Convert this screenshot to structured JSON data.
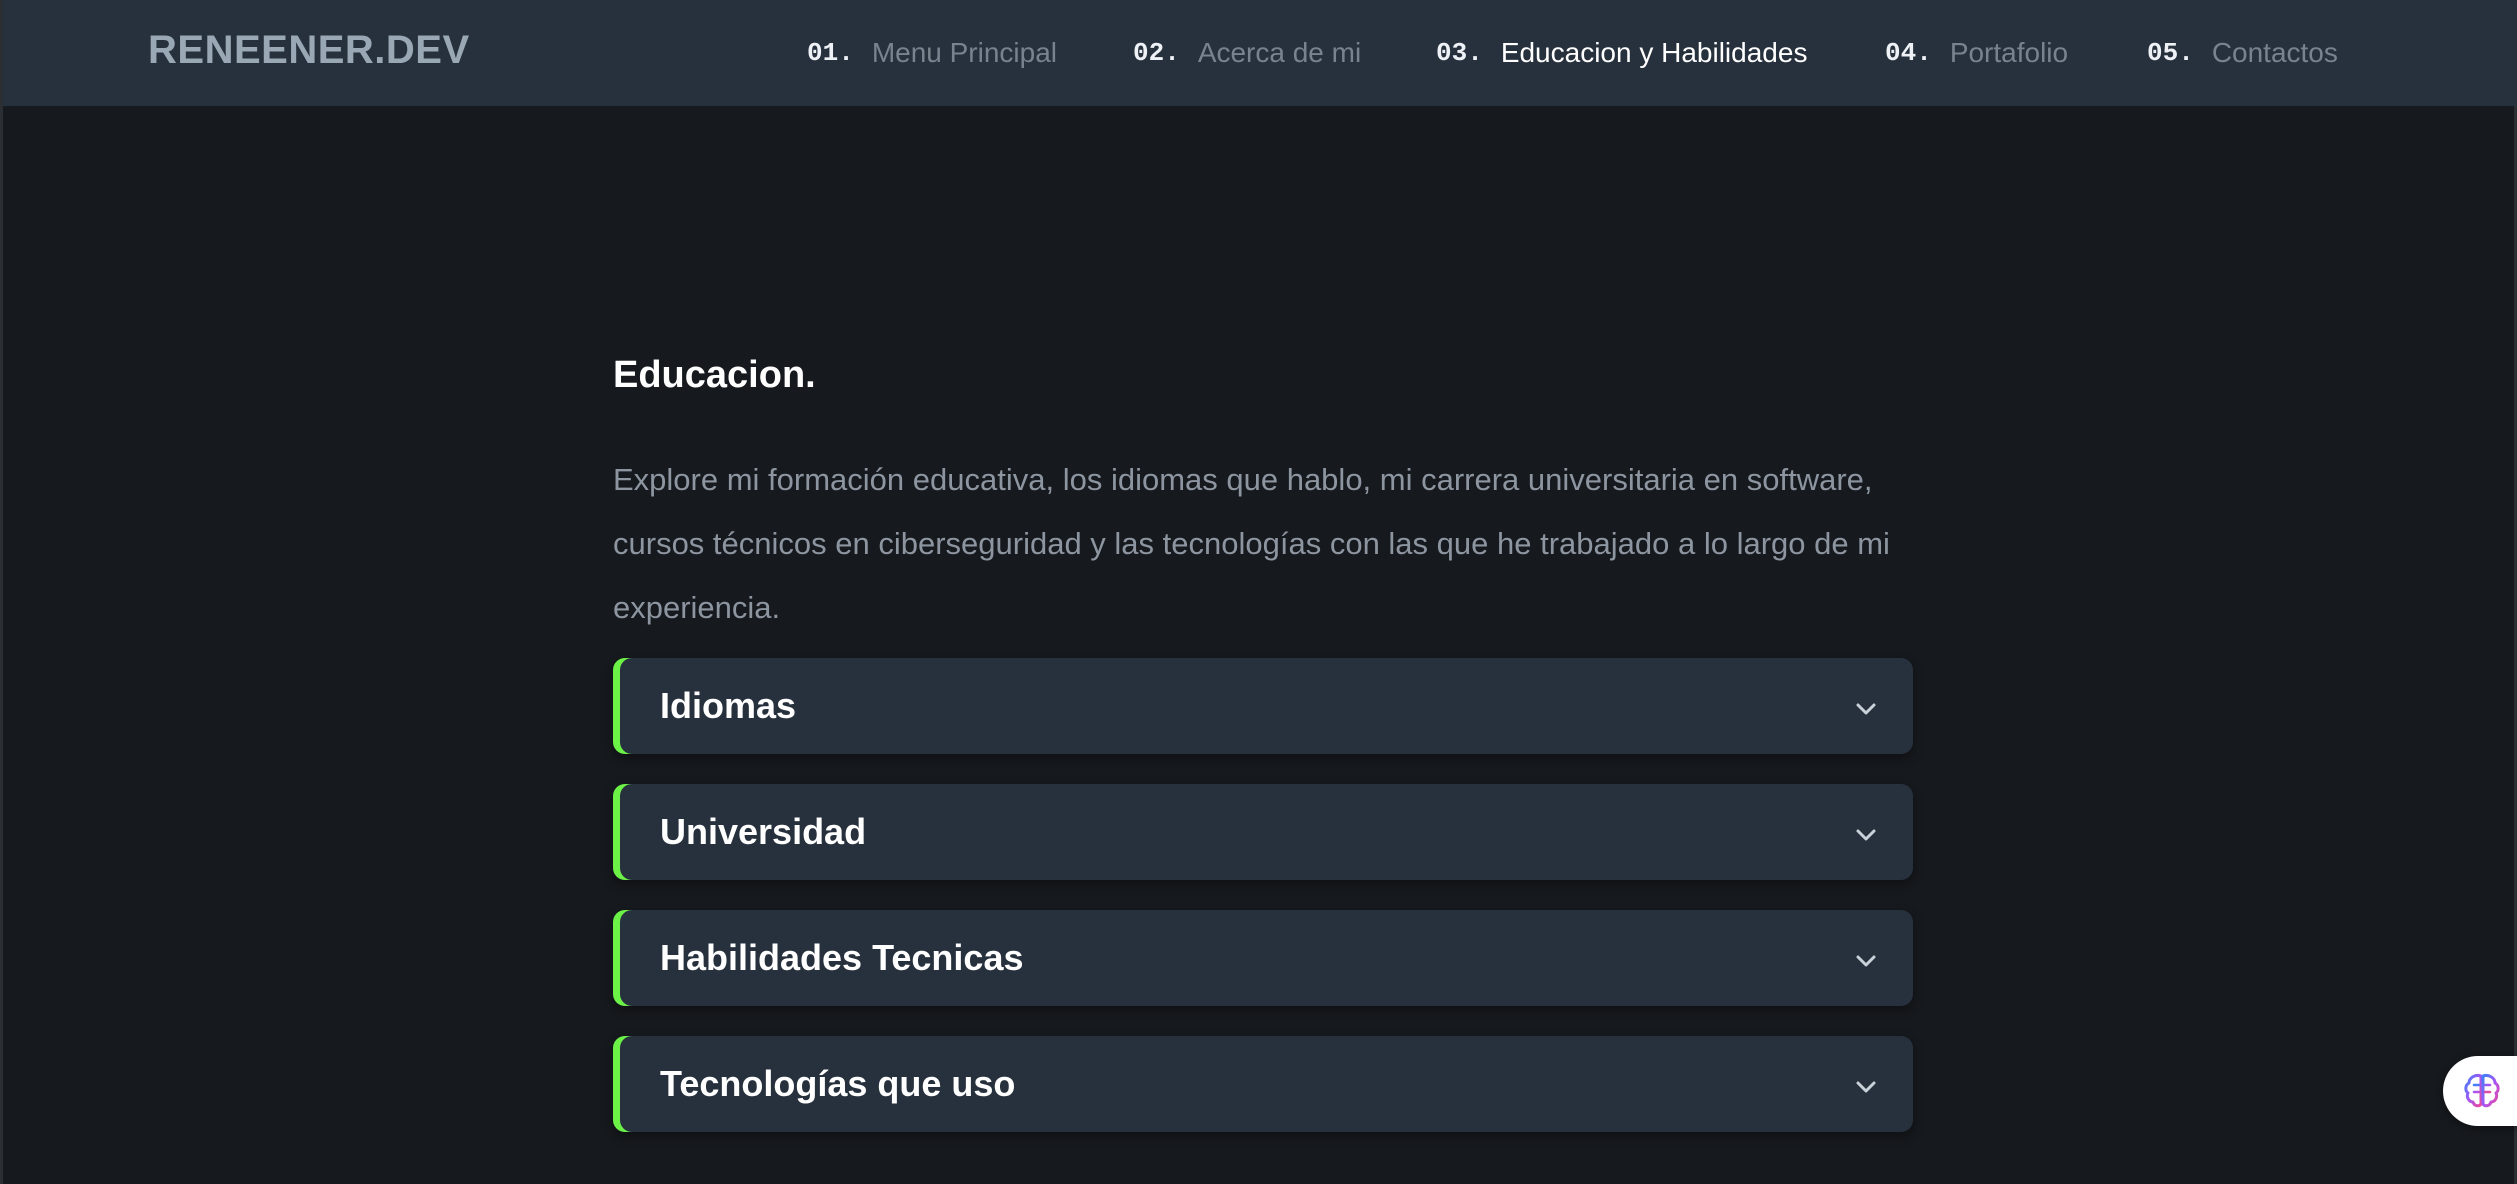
{
  "header": {
    "brand": "RENEENER.DEV",
    "nav": [
      {
        "num": "01.",
        "label": "Menu Principal"
      },
      {
        "num": "02.",
        "label": "Acerca de mi"
      },
      {
        "num": "03.",
        "label": "Educacion y Habilidades",
        "active": true
      },
      {
        "num": "04.",
        "label": "Portafolio"
      },
      {
        "num": "05.",
        "label": "Contactos"
      }
    ]
  },
  "main": {
    "title": "Educacion.",
    "description": "Explore mi formación educativa, los idiomas que hablo, mi carrera universitaria en software, cursos técnicos en ciberseguridad y las tecnologías con las que he trabajado a lo largo de mi experiencia.",
    "accordions": [
      {
        "title": "Idiomas",
        "icon": "chevron-down-icon"
      },
      {
        "title": "Universidad",
        "icon": "chevron-down-icon"
      },
      {
        "title": "Habilidades Tecnicas",
        "icon": "chevron-down-icon"
      },
      {
        "title": "Tecnologías que uso",
        "icon": "chevron-down-icon"
      }
    ]
  },
  "widget": {
    "icon": "brain-icon"
  },
  "colors": {
    "accent": "#6cf247",
    "navbar_bg": "#27313d",
    "page_bg": "#16191d",
    "card_bg": "#27313d",
    "muted_text": "#8c95a0"
  }
}
